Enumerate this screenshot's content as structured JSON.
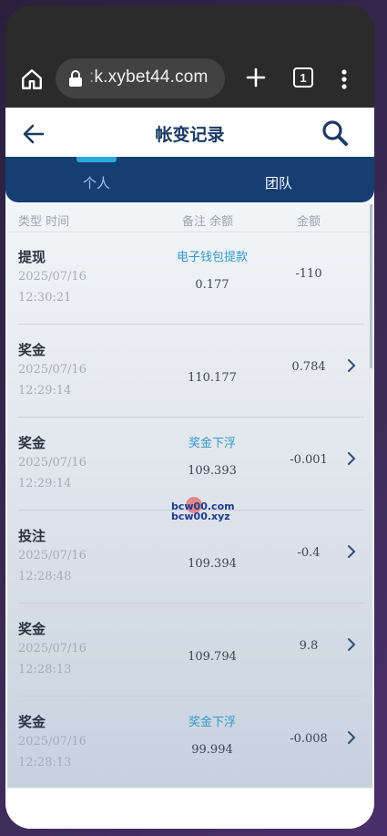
{
  "browser": {
    "url": "k.xybet44.com",
    "url_prefix": ":",
    "tab_count": "1"
  },
  "page": {
    "title": "帐变记录",
    "tabs": [
      {
        "label": "个人",
        "active": true
      },
      {
        "label": "团队",
        "active": false
      }
    ],
    "columns": {
      "type_time": "类型 时间",
      "note_balance": "备注 余额",
      "amount": "金额"
    }
  },
  "records": [
    {
      "type": "提现",
      "date": "2025/07/16",
      "time": "12:30:21",
      "note": "电子钱包提款",
      "balance": "0.177",
      "amount": "-110",
      "has_chevron": false
    },
    {
      "type": "奖金",
      "date": "2025/07/16",
      "time": "12:29:14",
      "note": "",
      "balance": "110.177",
      "amount": "0.784",
      "has_chevron": true
    },
    {
      "type": "奖金",
      "date": "2025/07/16",
      "time": "12:29:14",
      "note": "奖金下浮",
      "balance": "109.393",
      "amount": "-0.001",
      "has_chevron": true
    },
    {
      "type": "投注",
      "date": "2025/07/16",
      "time": "12:28:48",
      "note": "",
      "balance": "109.394",
      "amount": "-0.4",
      "has_chevron": true
    },
    {
      "type": "奖金",
      "date": "2025/07/16",
      "time": "12:28:13",
      "note": "",
      "balance": "109.794",
      "amount": "9.8",
      "has_chevron": true
    },
    {
      "type": "奖金",
      "date": "2025/07/16",
      "time": "12:28:13",
      "note": "奖金下浮",
      "balance": "99.994",
      "amount": "-0.008",
      "has_chevron": true
    }
  ],
  "watermark": {
    "line1": "bcw00.com",
    "line2": "bcw00.xyz"
  },
  "colors": {
    "title": "#1c3a63",
    "tab_bar": "#153e73",
    "note_accent": "#3199c9"
  }
}
